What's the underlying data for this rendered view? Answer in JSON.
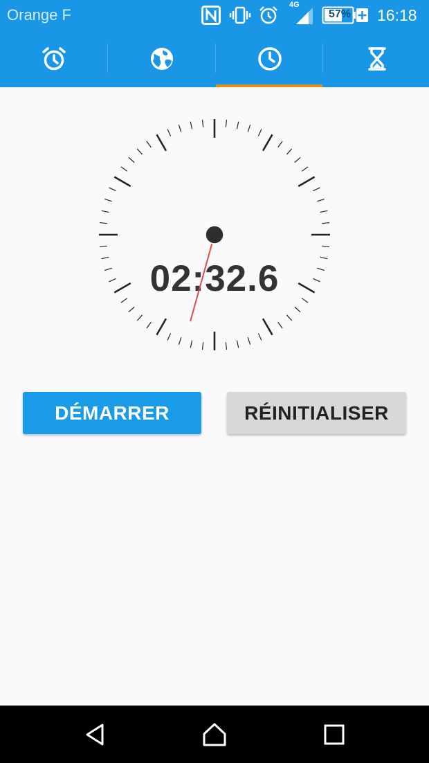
{
  "status_bar": {
    "carrier": "Orange F",
    "network": "4G",
    "battery_percent": "57%",
    "battery_charging": "+",
    "time": "16:18"
  },
  "tabs": [
    {
      "icon": "alarm-clock-icon",
      "selected": false
    },
    {
      "icon": "globe-icon",
      "selected": false
    },
    {
      "icon": "stopwatch-icon",
      "selected": true
    },
    {
      "icon": "hourglass-icon",
      "selected": false
    }
  ],
  "stopwatch": {
    "elapsed": "02:32.6",
    "seconds_hand_value": 32.6
  },
  "buttons": {
    "start_label": "DÉMARRER",
    "reset_label": "RÉINITIALISER"
  },
  "nav": {
    "back_icon": "back-triangle-icon",
    "home_icon": "home-icon",
    "recents_icon": "recents-square-icon"
  },
  "colors": {
    "primary": "#1a96e6",
    "indicator": "#e88a1c",
    "hand": "#e04a4a",
    "ticks": "#222222"
  }
}
